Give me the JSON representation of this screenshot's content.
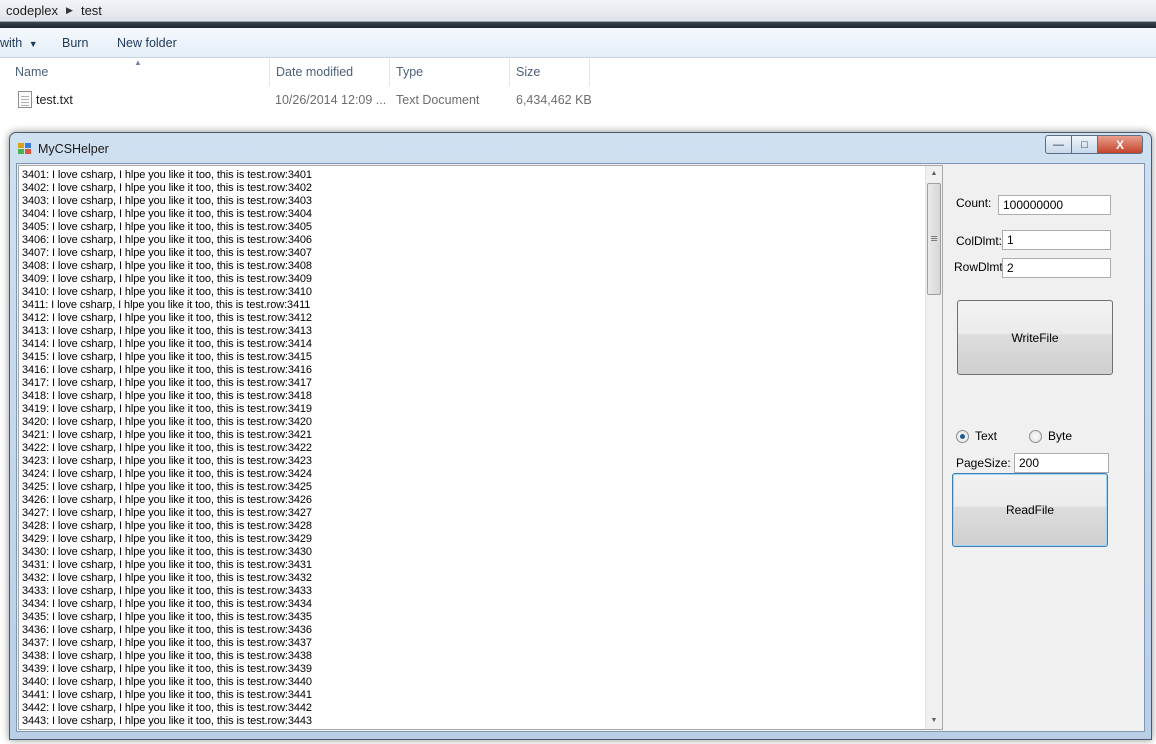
{
  "explorer": {
    "breadcrumb": [
      "codeplex",
      "test"
    ],
    "toolbar": {
      "open_with_label": "with",
      "burn_label": "Burn",
      "new_folder_label": "New folder"
    },
    "columns": [
      "Name",
      "Date modified",
      "Type",
      "Size"
    ],
    "file": {
      "name": "test.txt",
      "date_modified": "10/26/2014 12:09 ...",
      "type": "Text Document",
      "size": "6,434,462 KB"
    }
  },
  "window": {
    "title": "MyCSHelper",
    "controls": {
      "minimize": "—",
      "maximize": "□",
      "close": "X"
    },
    "text_lines": [
      "3401: I love csharp, I hlpe you like it too, this is test.row:3401",
      "3402: I love csharp, I hlpe you like it too, this is test.row:3402",
      "3403: I love csharp, I hlpe you like it too, this is test.row:3403",
      "3404: I love csharp, I hlpe you like it too, this is test.row:3404",
      "3405: I love csharp, I hlpe you like it too, this is test.row:3405",
      "3406: I love csharp, I hlpe you like it too, this is test.row:3406",
      "3407: I love csharp, I hlpe you like it too, this is test.row:3407",
      "3408: I love csharp, I hlpe you like it too, this is test.row:3408",
      "3409: I love csharp, I hlpe you like it too, this is test.row:3409",
      "3410: I love csharp, I hlpe you like it too, this is test.row:3410",
      "3411: I love csharp, I hlpe you like it too, this is test.row:3411",
      "3412: I love csharp, I hlpe you like it too, this is test.row:3412",
      "3413: I love csharp, I hlpe you like it too, this is test.row:3413",
      "3414: I love csharp, I hlpe you like it too, this is test.row:3414",
      "3415: I love csharp, I hlpe you like it too, this is test.row:3415",
      "3416: I love csharp, I hlpe you like it too, this is test.row:3416",
      "3417: I love csharp, I hlpe you like it too, this is test.row:3417",
      "3418: I love csharp, I hlpe you like it too, this is test.row:3418",
      "3419: I love csharp, I hlpe you like it too, this is test.row:3419",
      "3420: I love csharp, I hlpe you like it too, this is test.row:3420",
      "3421: I love csharp, I hlpe you like it too, this is test.row:3421",
      "3422: I love csharp, I hlpe you like it too, this is test.row:3422",
      "3423: I love csharp, I hlpe you like it too, this is test.row:3423",
      "3424: I love csharp, I hlpe you like it too, this is test.row:3424",
      "3425: I love csharp, I hlpe you like it too, this is test.row:3425",
      "3426: I love csharp, I hlpe you like it too, this is test.row:3426",
      "3427: I love csharp, I hlpe you like it too, this is test.row:3427",
      "3428: I love csharp, I hlpe you like it too, this is test.row:3428",
      "3429: I love csharp, I hlpe you like it too, this is test.row:3429",
      "3430: I love csharp, I hlpe you like it too, this is test.row:3430",
      "3431: I love csharp, I hlpe you like it too, this is test.row:3431",
      "3432: I love csharp, I hlpe you like it too, this is test.row:3432",
      "3433: I love csharp, I hlpe you like it too, this is test.row:3433",
      "3434: I love csharp, I hlpe you like it too, this is test.row:3434",
      "3435: I love csharp, I hlpe you like it too, this is test.row:3435",
      "3436: I love csharp, I hlpe you like it too, this is test.row:3436",
      "3437: I love csharp, I hlpe you like it too, this is test.row:3437",
      "3438: I love csharp, I hlpe you like it too, this is test.row:3438",
      "3439: I love csharp, I hlpe you like it too, this is test.row:3439",
      "3440: I love csharp, I hlpe you like it too, this is test.row:3440",
      "3441: I love csharp, I hlpe you like it too, this is test.row:3441",
      "3442: I love csharp, I hlpe you like it too, this is test.row:3442",
      "3443: I love csharp, I hlpe you like it too, this is test.row:3443"
    ],
    "count": {
      "label": "Count:",
      "value": "100000000"
    },
    "col_dlmt": {
      "label": "ColDlmt:",
      "value": "1"
    },
    "row_dlmt": {
      "label": "RowDlmt:",
      "value": "2"
    },
    "write_button": "WriteFile",
    "mode": {
      "options": [
        "Text",
        "Byte"
      ],
      "selected": "Text"
    },
    "page_size": {
      "label": "PageSize:",
      "value": "200"
    },
    "read_button": "ReadFile"
  },
  "icons": {
    "breadcrumb_separator": "triangle-right-icon",
    "dropdown": "chevron-down-icon",
    "file": "text-file-icon",
    "app": "app-icon"
  }
}
